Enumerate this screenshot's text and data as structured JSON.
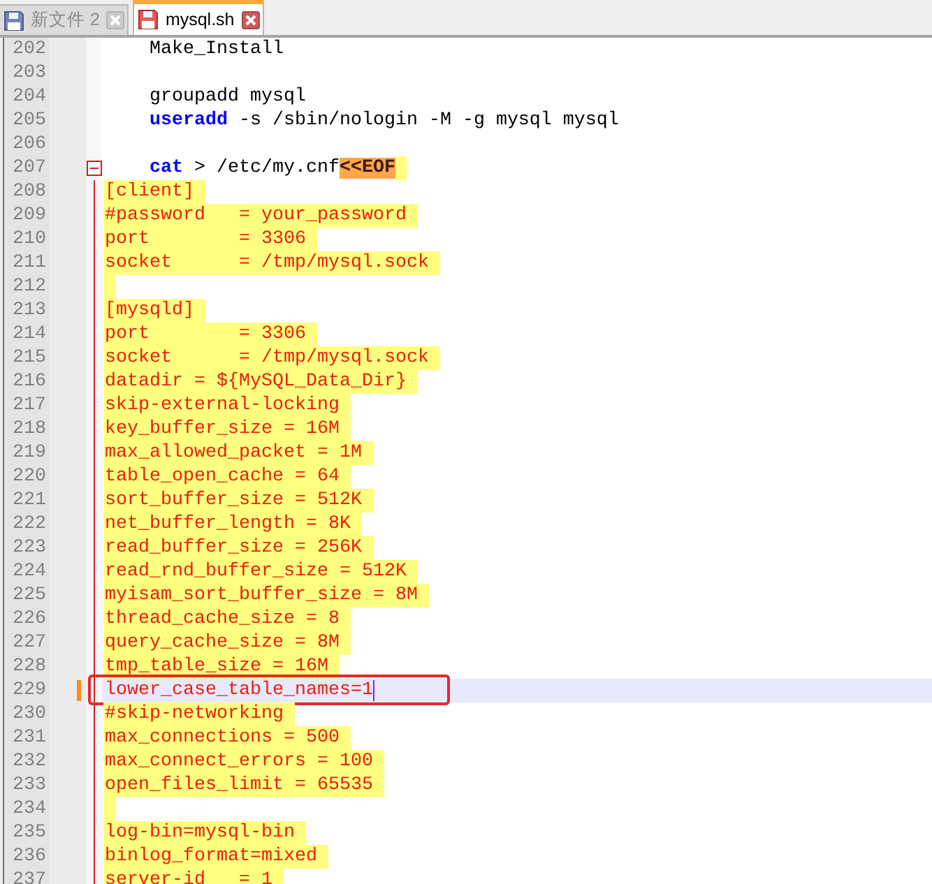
{
  "tabs": [
    {
      "label": "新文件 2",
      "selected": false,
      "modified": false
    },
    {
      "label": "mysql.sh",
      "selected": true,
      "modified": true
    }
  ],
  "editor": {
    "lines": [
      {
        "number": "202",
        "kind": "code",
        "segments": [
          {
            "kind": "plain",
            "text": "    Make_Install"
          }
        ],
        "current": false,
        "changed": false,
        "boxed": false
      },
      {
        "number": "203",
        "kind": "code",
        "current": false,
        "changed": false,
        "boxed": false
      },
      {
        "number": "204",
        "kind": "code",
        "segments": [
          {
            "kind": "plain",
            "text": "    groupadd mysql"
          }
        ],
        "current": false,
        "changed": false,
        "boxed": false
      },
      {
        "number": "205",
        "kind": "code",
        "segments": [
          {
            "kind": "keyword",
            "text": "    useradd"
          },
          {
            "kind": "plain",
            "text": " -s /sbin/nologin -M -g mysql mysql"
          }
        ],
        "current": false,
        "changed": false,
        "boxed": false
      },
      {
        "number": "206",
        "kind": "code",
        "current": false,
        "changed": false,
        "boxed": false
      },
      {
        "number": "207",
        "kind": "code",
        "segments": [
          {
            "kind": "keyword",
            "text": "    cat"
          },
          {
            "kind": "plain",
            "text": " > /etc/my.cnf"
          },
          {
            "kind": "heredoc_delim",
            "text": "<<EOF"
          }
        ],
        "expanded": true,
        "current": false,
        "changed": false,
        "boxed": false,
        "children": [
          {
            "number": "208",
            "kind": "heredoc",
            "text": "[client]",
            "current": false,
            "changed": false,
            "boxed": false
          },
          {
            "number": "209",
            "kind": "heredoc",
            "text": "#password   = your_password",
            "current": false,
            "changed": false,
            "boxed": false
          },
          {
            "number": "210",
            "kind": "heredoc",
            "text": "port        = 3306",
            "current": false,
            "changed": false,
            "boxed": false
          },
          {
            "number": "211",
            "kind": "heredoc",
            "text": "socket      = /tmp/mysql.sock",
            "current": false,
            "changed": false,
            "boxed": false
          },
          {
            "number": "212",
            "kind": "heredoc",
            "current": false,
            "changed": false,
            "boxed": false
          },
          {
            "number": "213",
            "kind": "heredoc",
            "text": "[mysqld]",
            "current": false,
            "changed": false,
            "boxed": false
          },
          {
            "number": "214",
            "kind": "heredoc",
            "text": "port        = 3306",
            "current": false,
            "changed": false,
            "boxed": false
          },
          {
            "number": "215",
            "kind": "heredoc",
            "text": "socket      = /tmp/mysql.sock",
            "current": false,
            "changed": false,
            "boxed": false
          },
          {
            "number": "216",
            "kind": "heredoc",
            "text": "datadir = ${MySQL_Data_Dir}",
            "current": false,
            "changed": false,
            "boxed": false
          },
          {
            "number": "217",
            "kind": "heredoc",
            "text": "skip-external-locking",
            "current": false,
            "changed": false,
            "boxed": false
          },
          {
            "number": "218",
            "kind": "heredoc",
            "text": "key_buffer_size = 16M",
            "current": false,
            "changed": false,
            "boxed": false
          },
          {
            "number": "219",
            "kind": "heredoc",
            "text": "max_allowed_packet = 1M",
            "current": false,
            "changed": false,
            "boxed": false
          },
          {
            "number": "220",
            "kind": "heredoc",
            "text": "table_open_cache = 64",
            "current": false,
            "changed": false,
            "boxed": false
          },
          {
            "number": "221",
            "kind": "heredoc",
            "text": "sort_buffer_size = 512K",
            "current": false,
            "changed": false,
            "boxed": false
          },
          {
            "number": "222",
            "kind": "heredoc",
            "text": "net_buffer_length = 8K",
            "current": false,
            "changed": false,
            "boxed": false
          },
          {
            "number": "223",
            "kind": "heredoc",
            "text": "read_buffer_size = 256K",
            "current": false,
            "changed": false,
            "boxed": false
          },
          {
            "number": "224",
            "kind": "heredoc",
            "text": "read_rnd_buffer_size = 512K",
            "current": false,
            "changed": false,
            "boxed": false
          },
          {
            "number": "225",
            "kind": "heredoc",
            "text": "myisam_sort_buffer_size = 8M",
            "current": false,
            "changed": false,
            "boxed": false
          },
          {
            "number": "226",
            "kind": "heredoc",
            "text": "thread_cache_size = 8",
            "current": false,
            "changed": false,
            "boxed": false
          },
          {
            "number": "227",
            "kind": "heredoc",
            "text": "query_cache_size = 8M",
            "current": false,
            "changed": false,
            "boxed": false
          },
          {
            "number": "228",
            "kind": "heredoc",
            "text": "tmp_table_size = 16M",
            "current": false,
            "changed": false,
            "boxed": false
          },
          {
            "number": "229",
            "kind": "heredoc",
            "text": "lower_case_table_names=1",
            "current": true,
            "changed": true,
            "boxed": true
          },
          {
            "number": "230",
            "kind": "heredoc",
            "text": "#skip-networking",
            "current": false,
            "changed": false,
            "boxed": false
          },
          {
            "number": "231",
            "kind": "heredoc",
            "text": "max_connections = 500",
            "current": false,
            "changed": false,
            "boxed": false
          },
          {
            "number": "232",
            "kind": "heredoc",
            "text": "max_connect_errors = 100",
            "current": false,
            "changed": false,
            "boxed": false
          },
          {
            "number": "233",
            "kind": "heredoc",
            "text": "open_files_limit = 65535",
            "current": false,
            "changed": false,
            "boxed": false
          },
          {
            "number": "234",
            "kind": "heredoc",
            "current": false,
            "changed": false,
            "boxed": false
          },
          {
            "number": "235",
            "kind": "heredoc",
            "text": "log-bin=mysql-bin",
            "current": false,
            "changed": false,
            "boxed": false
          },
          {
            "number": "236",
            "kind": "heredoc",
            "text": "binlog_format=mixed",
            "current": false,
            "changed": false,
            "boxed": false
          },
          {
            "number": "237",
            "kind": "heredoc",
            "text": "server-id   = 1",
            "current": false,
            "changed": false,
            "boxed": false
          }
        ]
      }
    ]
  }
}
